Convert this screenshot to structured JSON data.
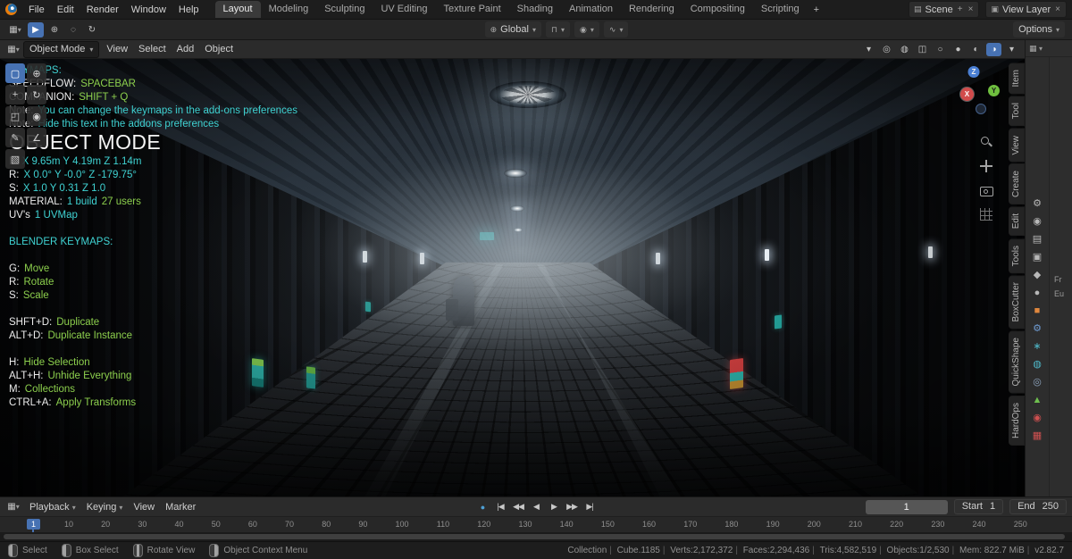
{
  "colors": {
    "accent": "#4772b3",
    "cyan": "#3fd2d2",
    "green": "#8ccf4d"
  },
  "ui": {
    "caret": "▾",
    "close": "×",
    "editor_glyph": "▦",
    "scene_glyph": "▤",
    "layers_glyph": "▣",
    "add": "+"
  },
  "topbar": {
    "menus": [
      "File",
      "Edit",
      "Render",
      "Window",
      "Help"
    ],
    "tabs": [
      {
        "label": "Layout",
        "active": true
      },
      {
        "label": "Modeling"
      },
      {
        "label": "Sculpting"
      },
      {
        "label": "UV Editing"
      },
      {
        "label": "Texture Paint"
      },
      {
        "label": "Shading"
      },
      {
        "label": "Animation"
      },
      {
        "label": "Rendering"
      },
      {
        "label": "Compositing"
      },
      {
        "label": "Scripting"
      }
    ],
    "add_workspace": "+",
    "scene": {
      "label": "Scene"
    },
    "view_layer": {
      "label": "View Layer"
    }
  },
  "tool_settings": {
    "left_icons": [
      {
        "name": "active-tool-select-button",
        "glyph": "▶",
        "active": true
      },
      {
        "name": "tweak-tool-icon",
        "glyph": "⊕"
      },
      {
        "name": "select-circle-icon",
        "glyph": "◌"
      },
      {
        "name": "select-lasso-icon",
        "glyph": "↻"
      }
    ],
    "orientation_label": "Global",
    "widgets": [
      {
        "name": "snap-widget",
        "glyph": "⊓"
      },
      {
        "name": "proportional-editing-widget",
        "glyph": "◉"
      },
      {
        "name": "falloff-widget",
        "glyph": "∿"
      }
    ],
    "options_label": "Options"
  },
  "viewport_header": {
    "mode": "Object Mode",
    "menus": [
      "View",
      "Select",
      "Add",
      "Object"
    ],
    "right_icons": [
      {
        "name": "object-visibility-dropdown",
        "glyph": "▾"
      },
      {
        "name": "gizmos-toggle",
        "glyph": "◎"
      },
      {
        "name": "overlays-toggle",
        "glyph": "◍"
      },
      {
        "name": "xray-toggle",
        "glyph": "◫"
      },
      {
        "name": "shading-wireframe-button",
        "glyph": "○"
      },
      {
        "name": "shading-solid-button",
        "glyph": "●"
      },
      {
        "name": "shading-material-button",
        "glyph": "◐"
      },
      {
        "name": "shading-rendered-button",
        "glyph": "◑",
        "active": true
      },
      {
        "name": "shading-dropdown",
        "glyph": "▾"
      }
    ]
  },
  "toolbar_tools": [
    {
      "name": "select-box-tool",
      "glyph": "▢",
      "active": true
    },
    {
      "name": "cursor-tool",
      "glyph": "⊕"
    },
    {
      "name": "move-tool",
      "glyph": "+"
    },
    {
      "name": "rotate-tool",
      "glyph": "↻"
    },
    {
      "name": "scale-tool",
      "glyph": "◰"
    },
    {
      "name": "transform-tool",
      "glyph": "◉"
    },
    {
      "name": "annotate-tool",
      "glyph": "✎"
    },
    {
      "name": "measure-tool",
      "glyph": "∠"
    },
    {
      "name": "add-cube-tool",
      "glyph": "▧"
    }
  ],
  "gizmo": {
    "x": "X",
    "y": "Y",
    "z": "Z"
  },
  "hud": {
    "top_lines": [
      {
        "label": "KEYMAPS:",
        "lc": "cyan"
      },
      {
        "label": "SPEEDFLOW:",
        "value": "SPACEBAR",
        "vc": "green"
      },
      {
        "label": "COMPANION:",
        "value": "SHIFT + Q",
        "vc": "green"
      },
      {
        "label": "Note:",
        "value": "You can change the keymaps in the add-ons preferences",
        "vc": "cyan"
      },
      {
        "label": "Note:",
        "value": "Hide this text in the addons preferences",
        "vc": "cyan"
      }
    ],
    "title": "OBJECT MODE",
    "lines": [
      {
        "label": "L:",
        "value": "X 9.65m Y 4.19m Z 1.14m",
        "vc": "cyan"
      },
      {
        "label": "R:",
        "value": "X 0.0° Y -0.0° Z -179.75°",
        "vc": "cyan"
      },
      {
        "label": "S:",
        "value": "X 1.0 Y 0.31 Z 1.0",
        "vc": "cyan"
      },
      {
        "label": "MATERIAL:",
        "value": "1 build",
        "vc": "cyan",
        "value2": "27 users",
        "v2c": "green"
      },
      {
        "label": "UV's",
        "value": "1 UVMap",
        "vc": "cyan"
      },
      {
        "label": ""
      },
      {
        "label": "BLENDER KEYMAPS:",
        "lc": "cyan"
      },
      {
        "label": ""
      },
      {
        "label": "G:",
        "value": "Move",
        "vc": "green"
      },
      {
        "label": "R:",
        "value": "Rotate",
        "vc": "green"
      },
      {
        "label": "S:",
        "value": "Scale",
        "vc": "green"
      },
      {
        "label": ""
      },
      {
        "label": "SHFT+D:",
        "value": "Duplicate",
        "vc": "green"
      },
      {
        "label": "ALT+D:",
        "value": "Duplicate Instance",
        "vc": "green"
      },
      {
        "label": ""
      },
      {
        "label": "H:",
        "value": "Hide Selection",
        "vc": "green"
      },
      {
        "label": "ALT+H:",
        "value": "Unhide Everything",
        "vc": "green"
      },
      {
        "label": "M:",
        "value": "Collections",
        "vc": "green"
      },
      {
        "label": "CTRL+A:",
        "value": "Apply Transforms",
        "vc": "green"
      }
    ]
  },
  "npanel_tabs": [
    "Item",
    "Tool",
    "View",
    "Create",
    "Edit",
    "Tools",
    "BoxCutter",
    "QuickShape",
    "HardOps"
  ],
  "rail": {
    "icons": [
      {
        "name": "tool-properties-icon",
        "glyph": "⚙",
        "style": "color:#b8b8b8"
      },
      {
        "name": "render-properties-icon",
        "glyph": "◉",
        "style": "color:#b8b8b8"
      },
      {
        "name": "output-properties-icon",
        "glyph": "▤",
        "style": "color:#b8b8b8"
      },
      {
        "name": "view-layer-properties-icon",
        "glyph": "▣",
        "style": "color:#b8b8b8"
      },
      {
        "name": "scene-properties-icon",
        "glyph": "◆",
        "style": "color:#b8b8b8"
      },
      {
        "name": "world-properties-icon",
        "glyph": "●",
        "style": "color:#b8b8b8"
      },
      {
        "name": "object-properties-icon",
        "glyph": "■",
        "style": "color:#e0883e"
      },
      {
        "name": "modifier-properties-icon",
        "glyph": "⚙",
        "style": "color:#6f9bd1"
      },
      {
        "name": "particles-properties-icon",
        "glyph": "∗",
        "style": "color:#4fb8c9"
      },
      {
        "name": "physics-properties-icon",
        "glyph": "◍",
        "style": "color:#4fb8c9"
      },
      {
        "name": "constraints-properties-icon",
        "glyph": "◎",
        "style": "color:#8fa5c0"
      },
      {
        "name": "object-data-properties-icon",
        "glyph": "▲",
        "style": "color:#6fbf4f"
      },
      {
        "name": "material-properties-icon",
        "glyph": "◉",
        "style": "color:#cf5050"
      },
      {
        "name": "texture-properties-icon",
        "glyph": "▦",
        "style": "color:#cf5050"
      }
    ],
    "sliver_labels": [
      "Fr",
      "Eu"
    ]
  },
  "timeline": {
    "menus": [
      {
        "label": "Playback",
        "caret": "▾"
      },
      {
        "label": "Keying",
        "caret": "▾"
      },
      {
        "label": "View"
      },
      {
        "label": "Marker"
      }
    ],
    "transport": [
      {
        "name": "auto-keying-toggle",
        "glyph": "●",
        "style": "color:#4e9fd4"
      },
      {
        "name": "jump-to-start-button",
        "glyph": "|◀"
      },
      {
        "name": "prev-keyframe-button",
        "glyph": "◀◀"
      },
      {
        "name": "play-reverse-button",
        "glyph": "◀"
      },
      {
        "name": "play-button",
        "glyph": "▶"
      },
      {
        "name": "next-keyframe-button",
        "glyph": "▶▶"
      },
      {
        "name": "jump-to-end-button",
        "glyph": "▶|"
      }
    ],
    "current_frame": "1",
    "start_label": "Start",
    "start_value": "1",
    "end_label": "End",
    "end_value": "250",
    "ruler": [
      "10",
      "20",
      "30",
      "40",
      "50",
      "60",
      "70",
      "80",
      "90",
      "100",
      "110",
      "120",
      "130",
      "140",
      "150",
      "160",
      "170",
      "180",
      "190",
      "200",
      "210",
      "220",
      "230",
      "240",
      "250"
    ]
  },
  "statusbar": {
    "hints": [
      {
        "button": "left",
        "label": "Select"
      },
      {
        "button": "left",
        "label": "Box Select"
      },
      {
        "button": "middle",
        "label": "Rotate View"
      },
      {
        "button": "right",
        "label": "Object Context Menu"
      }
    ],
    "stats": [
      "Collection",
      "Cube.1185",
      "Verts:2,172,372",
      "Faces:2,294,436",
      "Tris:4,582,519",
      "Objects:1/2,530",
      "Mem: 822.7 MiB",
      "v2.82.7"
    ]
  }
}
